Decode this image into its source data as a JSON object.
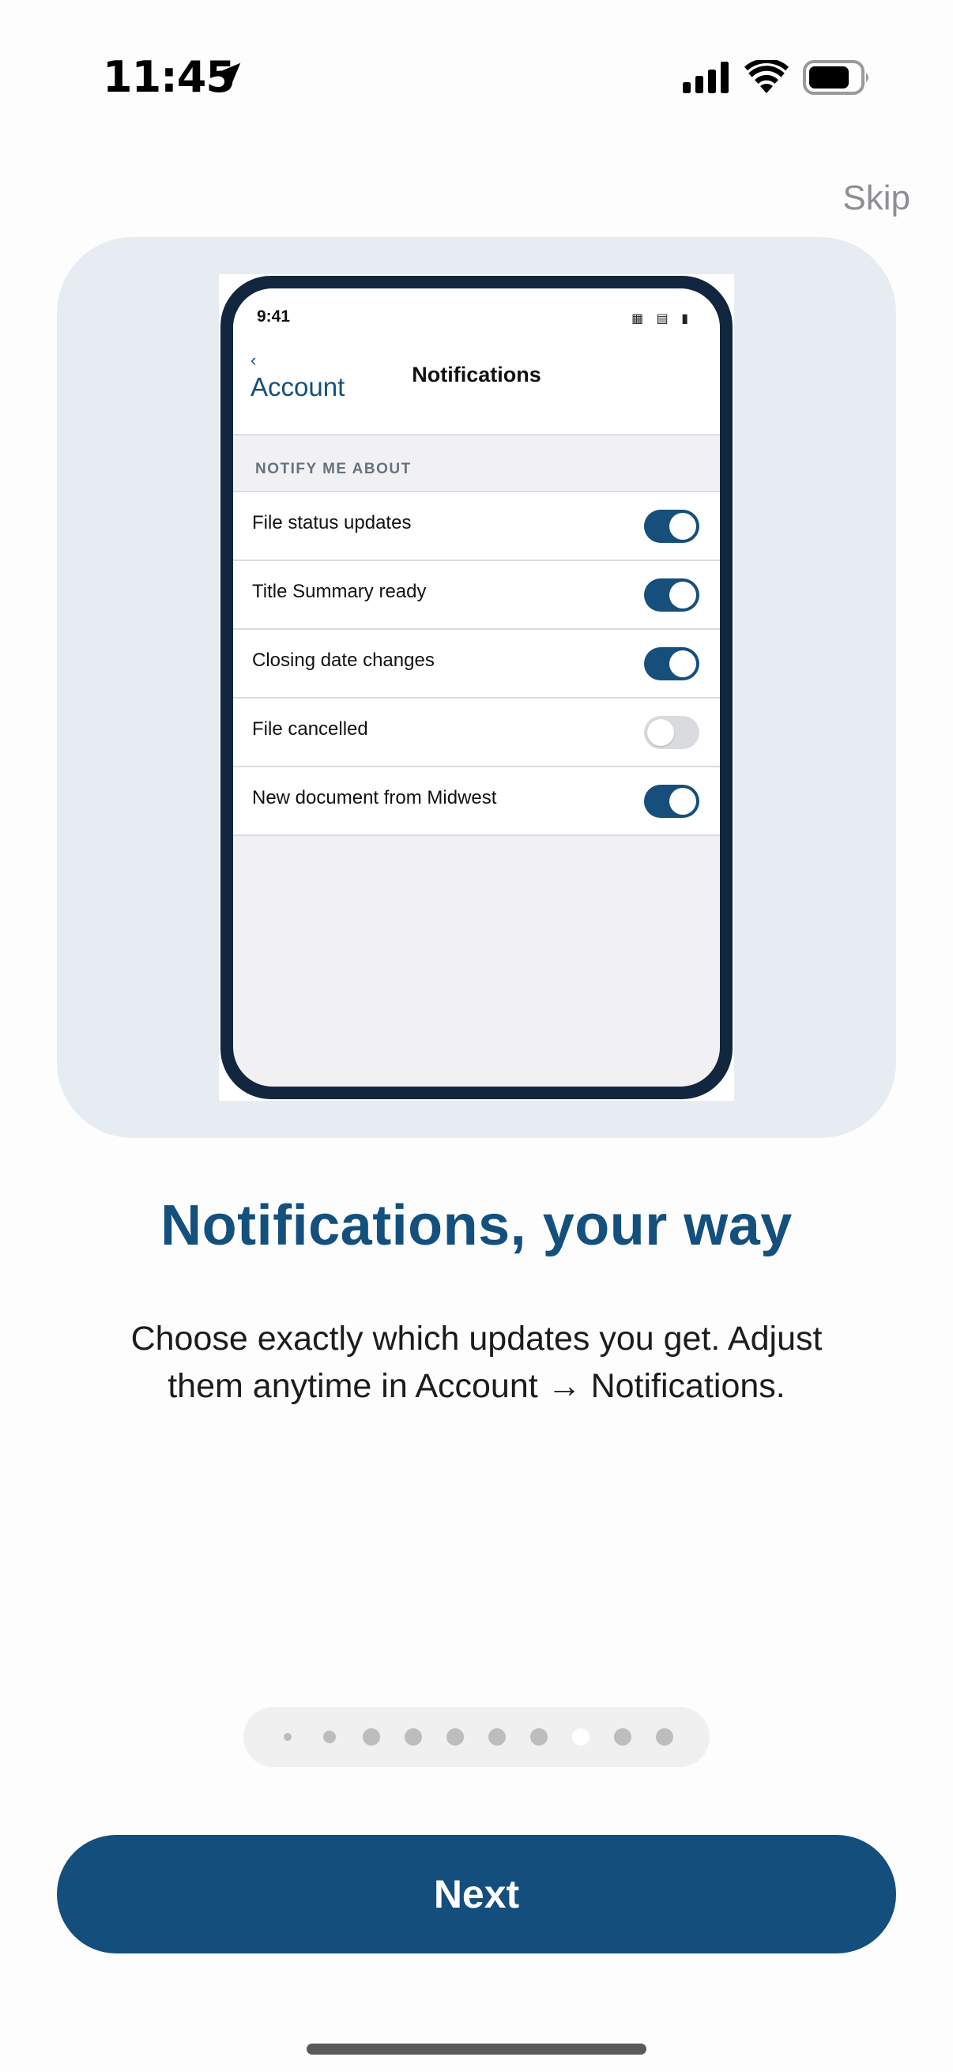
{
  "status_bar": {
    "time": "11:45",
    "icons": [
      "location-arrow-icon",
      "cellular-signal-icon",
      "wifi-icon",
      "battery-icon"
    ]
  },
  "skip_label": "Skip",
  "preview": {
    "status_time": "9:41",
    "status_icons": "▦ ▤ ▮",
    "back_chevron": "‹",
    "back_label": "Account",
    "title": "Notifications",
    "section_header": "NOTIFY ME ABOUT",
    "rows": [
      {
        "label": "File status updates",
        "on": true
      },
      {
        "label": "Title Summary ready",
        "on": true
      },
      {
        "label": "Closing date changes",
        "on": true
      },
      {
        "label": "File cancelled",
        "on": false
      },
      {
        "label": "New document from Midwest",
        "on": true
      }
    ]
  },
  "headline": "Notifications, your way",
  "body_line1": "Choose exactly which updates you get. Adjust",
  "body_line2": "them anytime in Account → Notifications.",
  "pagination": {
    "total": 10,
    "active_index": 7
  },
  "next_label": "Next",
  "colors": {
    "brand": "#144e7d",
    "hero_bg": "#e7ecf3",
    "phone_frame": "#12263f",
    "toggle_off": "#dadbde"
  }
}
